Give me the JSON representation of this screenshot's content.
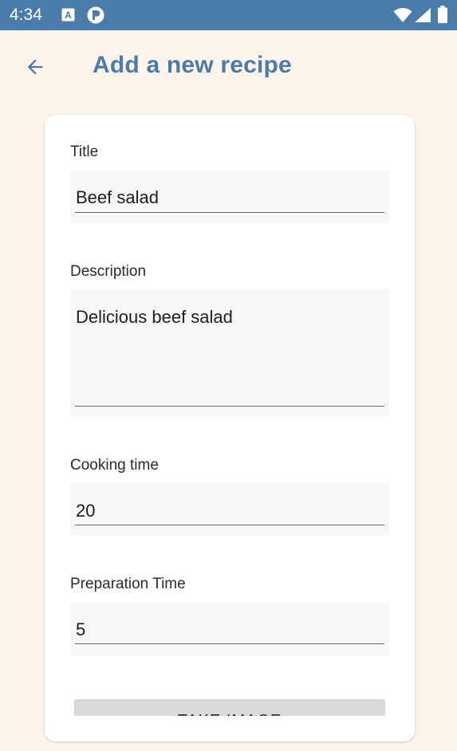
{
  "status_bar": {
    "time": "4:34",
    "icons": [
      "a-notification-icon",
      "p-notification-icon",
      "wifi-icon",
      "signal-icon",
      "battery-icon"
    ]
  },
  "app_bar": {
    "back_icon": "arrow-back-icon",
    "title": "Add a new recipe"
  },
  "form": {
    "title": {
      "label": "Title",
      "value": "Beef salad"
    },
    "description": {
      "label": "Description",
      "value": "Delicious beef salad"
    },
    "cooking_time": {
      "label": "Cooking time",
      "value": "20"
    },
    "preparation_time": {
      "label": "Preparation Time",
      "value": "5"
    },
    "take_image_button": "TAKE IMAGE"
  },
  "colors": {
    "status_bar": "#4a7cab",
    "background": "#fdf4ec",
    "accent": "#4a7cab",
    "field_bg": "#f6f7f9",
    "button_bg": "#d9d9d9"
  }
}
